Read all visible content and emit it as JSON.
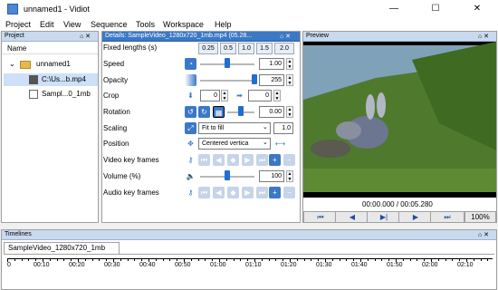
{
  "window": {
    "title": "unnamed1 - Vidiot",
    "minimize": "—",
    "maximize": "☐",
    "close": "✕"
  },
  "menu": [
    "Project",
    "Edit",
    "View",
    "Sequence",
    "Tools",
    "Workspace",
    "Help"
  ],
  "project": {
    "title": "Project",
    "column": "Name",
    "folder": "unnamed1",
    "files": [
      "C:\\Us...b.mp4",
      "Sampl...0_1mb"
    ],
    "controls": "⌂ ✕"
  },
  "details": {
    "title": "Details: SampleVideo_1280x720_1mb.mp4 (05.28...",
    "controls": "⌂ ✕",
    "labels": {
      "fixed": "Fixed lengths (s)",
      "speed": "Speed",
      "opacity": "Opacity",
      "crop": "Crop",
      "rotation": "Rotation",
      "scaling": "Scaling",
      "position": "Position",
      "video_kf": "Video key frames",
      "volume": "Volume (%)",
      "audio_kf": "Audio key frames"
    },
    "lengths": [
      "0.25",
      "0.5",
      "1.0",
      "1.5",
      "2.0"
    ],
    "speed": "1.00",
    "opacity": "255",
    "crop_a": "0",
    "crop_b": "0",
    "rotation": "0.00",
    "scaling": "Fit to fill",
    "scaling_extra": "1.0",
    "position": "Centered vertica",
    "volume": "100",
    "levels": {
      "speed": 0.5,
      "opacity": 1.0,
      "rotation": 0.5,
      "volume": 0.5
    }
  },
  "preview": {
    "title": "Preview",
    "controls": "⌂ ✕",
    "time": "00:00.000 / 00:05.280",
    "zoom": "100%",
    "buttons": [
      "⏮",
      "◀",
      "▶|",
      "▶",
      "⏭"
    ]
  },
  "timelines": {
    "title": "Timelines",
    "controls": "⌂ ✕",
    "tab": "SampleVideo_1280x720_1mb",
    "ticks": [
      "0",
      "00:10",
      "00:20",
      "00:30",
      "00:40",
      "00:50",
      "01:00",
      "01:10",
      "01:20",
      "01:30",
      "01:40",
      "01:50",
      "02:00",
      "02:10"
    ]
  }
}
